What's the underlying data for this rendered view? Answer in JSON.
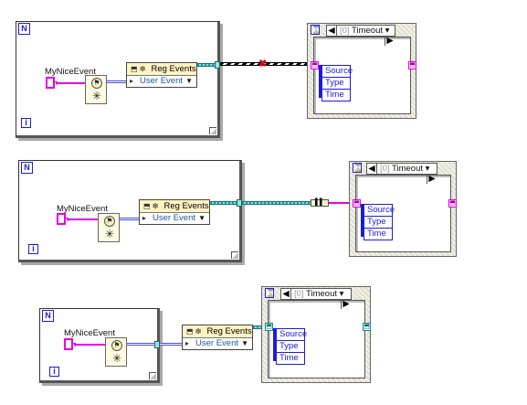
{
  "diagrams": [
    {
      "loop_count_label": "N",
      "loop_iteration_label": "i",
      "event_name": "MyNiceEvent",
      "reg_events_label": "Reg Events",
      "reg_events_input": "User Event",
      "case_index": "[0]",
      "case_name": "Timeout",
      "event_data": [
        "Source",
        "Type",
        "Time"
      ],
      "wire_state": "broken"
    },
    {
      "loop_count_label": "N",
      "loop_iteration_label": "i",
      "event_name": "MyNiceEvent",
      "reg_events_label": "Reg Events",
      "reg_events_input": "User Event",
      "case_index": "[0]",
      "case_name": "Timeout",
      "event_data": [
        "Source",
        "Type",
        "Time"
      ],
      "wire_state": "coerced"
    },
    {
      "loop_count_label": "N",
      "loop_iteration_label": "i",
      "event_name": "MyNiceEvent",
      "reg_events_label": "Reg Events",
      "reg_events_input": "User Event",
      "case_index": "[0]",
      "case_name": "Timeout",
      "event_data": [
        "Source",
        "Type",
        "Time"
      ],
      "wire_state": "ok"
    }
  ]
}
